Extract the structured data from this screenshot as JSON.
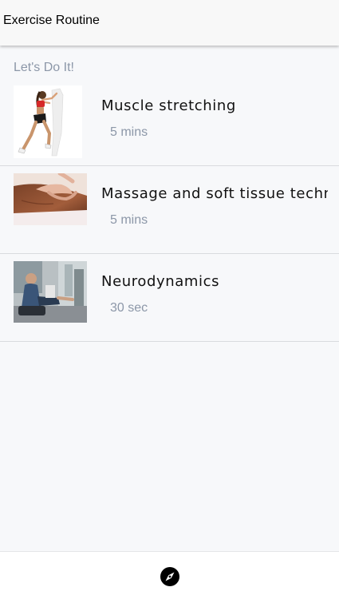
{
  "header": {
    "title": "Exercise Routine"
  },
  "section": {
    "label": "Let's Do It!"
  },
  "exercises": [
    {
      "title": "Muscle stretching",
      "duration": "5 mins",
      "image": "stretching-woman-thumbnail"
    },
    {
      "title": "Massage and soft tissue techniq",
      "duration": "5 mins",
      "image": "back-massage-thumbnail"
    },
    {
      "title": "Neurodynamics",
      "duration": "30 sec",
      "image": "seated-nerve-exercise-thumbnail"
    }
  ],
  "tabbar": {
    "icon": "compass-icon"
  },
  "colors": {
    "muted_text": "#8c97a8",
    "background": "#f7f8fa",
    "header_bg": "#f8f8f8",
    "divider": "#d9dbde"
  }
}
